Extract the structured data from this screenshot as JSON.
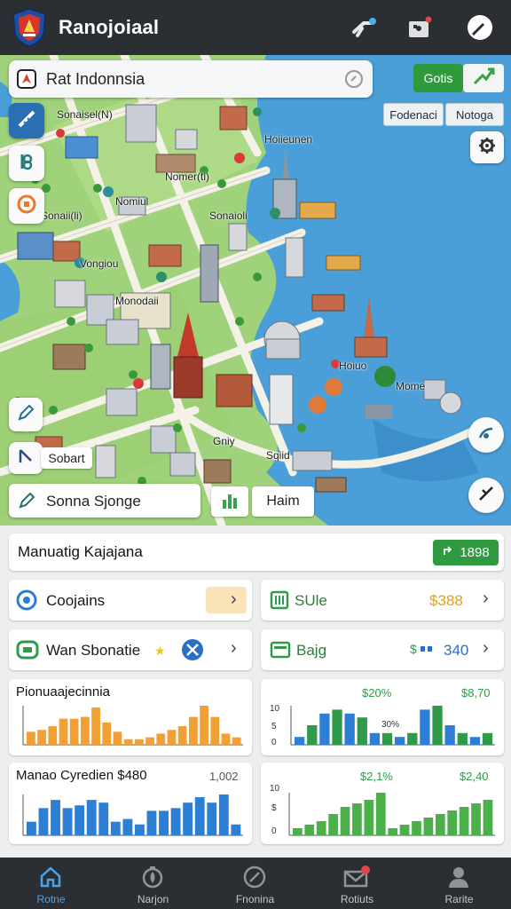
{
  "header": {
    "title": "Ranojoiaal",
    "icons": [
      "logo-shield-icon",
      "share-icon",
      "puzzle-icon",
      "compass-icon"
    ]
  },
  "map": {
    "search_text": "Rat Indonnsia",
    "buttons": {
      "green_label": "Gotis",
      "chip_1": "Fodenaci",
      "chip_2": "Notoga"
    },
    "labels": [
      "Sonaisel(N)",
      "Hoiieunen",
      "Nomer(ti)",
      "Nomiul",
      "Sonaii(li)",
      "Sonaioli",
      "Monodaii",
      "Vongiou",
      "Hoiuo",
      "Mome",
      "Gniy",
      "Sqiid"
    ],
    "bottom_search_text": "Sonna Sjonge",
    "chip_sobart": "Sobart",
    "chip_hairim": "Haim",
    "colors": {
      "water": "#4a9fd8",
      "land": "#a6d67f",
      "road": "#f4f1e8"
    }
  },
  "summary": {
    "title": "Manuatig Kajajana",
    "badge_value": "1898"
  },
  "cards": {
    "c1": {
      "label": "Coojains",
      "chev": "›"
    },
    "c2": {
      "label": "SUle",
      "value": "$388",
      "chev": "›"
    },
    "c3": {
      "label": "Wan Sbonatie",
      "chev": "›"
    },
    "c4": {
      "label": "Bajg",
      "value": "340",
      "chev": "›"
    }
  },
  "charts_meta": {
    "ch1": {
      "title": "Pionuaajecinnia"
    },
    "ch2": {
      "note_a": "$20%",
      "note_b": "$8,70",
      "note_c": "30%",
      "ticks": [
        "10",
        "5",
        "0"
      ]
    },
    "ch3": {
      "title": "Manao Cyredien $480",
      "note": "1,002"
    },
    "ch4": {
      "note_a": "$2,1%",
      "note_b": "$2,40",
      "ticks": [
        "10",
        "$",
        "0"
      ]
    }
  },
  "chart_data": [
    {
      "type": "bar",
      "title": "Pionuaajecinnia",
      "series": [
        {
          "values": [
            14,
            16,
            20,
            28,
            28,
            30,
            40,
            24,
            14,
            6,
            6,
            8,
            12,
            16,
            20,
            30,
            42,
            30,
            12,
            8
          ]
        }
      ],
      "color": "#f0a035"
    },
    {
      "type": "bar",
      "series": [
        {
          "values": [
            2,
            5,
            8,
            9,
            8,
            7,
            3,
            3
          ],
          "color": "#2d7fd6"
        },
        {
          "values": [
            2,
            3,
            9,
            10,
            5,
            3,
            2,
            3
          ],
          "color": "#2e9a4a"
        }
      ],
      "ylim": [
        0,
        10
      ]
    },
    {
      "type": "bar",
      "title": "Manao Cyredien $480",
      "series": [
        {
          "values": [
            10,
            20,
            26,
            20,
            22,
            26,
            24,
            10,
            12,
            8,
            18,
            18,
            20,
            24,
            28,
            24,
            30,
            8
          ]
        }
      ],
      "color": "#2d7fd6"
    },
    {
      "type": "bar",
      "series": [
        {
          "values": [
            2,
            3,
            4,
            6,
            8,
            9,
            10,
            12,
            2,
            3,
            4,
            5,
            6,
            7,
            8,
            9,
            10
          ]
        }
      ],
      "color": "#4bb04a",
      "ylim": [
        0,
        10
      ]
    }
  ],
  "tabbar": {
    "tabs": [
      {
        "label": "Rotne",
        "icon": "home-icon"
      },
      {
        "label": "Narjon",
        "icon": "flame-icon"
      },
      {
        "label": "Fnonina",
        "icon": "compass-icon"
      },
      {
        "label": "Rotiuts",
        "icon": "mail-icon"
      },
      {
        "label": "Rarite",
        "icon": "person-icon"
      }
    ]
  }
}
